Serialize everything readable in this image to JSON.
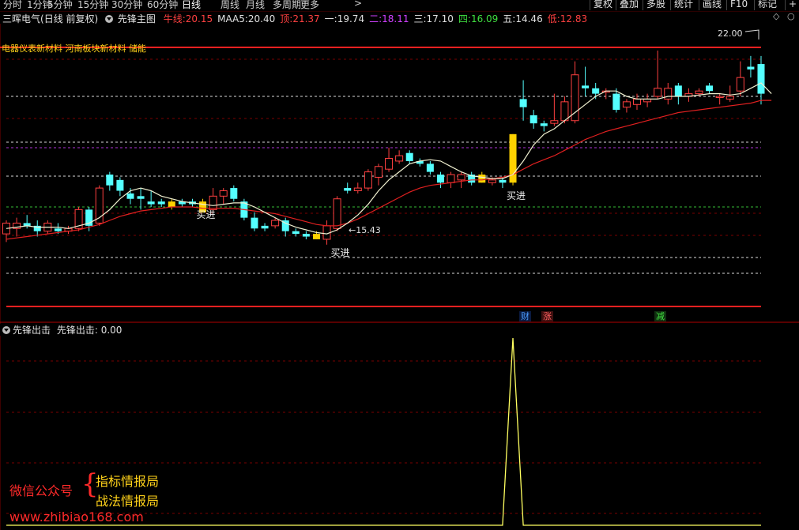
{
  "toolbar": {
    "periods": [
      "分时",
      "1分钟",
      "5分钟",
      "15分钟",
      "30分钟",
      "60分钟",
      "日线",
      "周线",
      "月线",
      "多周期",
      "更多"
    ],
    "active_period": "日线",
    "more_arrow": ">",
    "right_buttons": [
      "复权",
      "叠加",
      "多股",
      "统计",
      "画线",
      "F10",
      "标记"
    ],
    "end_mark": "+"
  },
  "main_panel": {
    "stock": "三晖电气",
    "adjust": "(日线 前复权)",
    "indicator": "先锋主图",
    "values": [
      {
        "label": "牛线:",
        "value": "20.15",
        "color": "#ff4040"
      },
      {
        "label": "MAA5:",
        "value": "20.40",
        "color": "#e0e0e0"
      },
      {
        "label": "顶:",
        "value": "21.37",
        "color": "#ff4040"
      },
      {
        "label": "一:",
        "value": "19.74",
        "color": "#e0e0e0"
      },
      {
        "label": "二:",
        "value": "18.11",
        "color": "#d040ff"
      },
      {
        "label": "三:",
        "value": "17.10",
        "color": "#e0e0e0"
      },
      {
        "label": "四:",
        "value": "16.09",
        "color": "#40e040"
      },
      {
        "label": "五:",
        "value": "14.46",
        "color": "#e0e0e0"
      },
      {
        "label": "低:",
        "value": "12.83",
        "color": "#ff4040"
      }
    ],
    "sectors": "电器仪表新材料 河南板块新材料 储能",
    "high_label": "22.00",
    "low_label": "←15.43",
    "buy_label": "买进",
    "tags": [
      {
        "text": "财",
        "color": "#4a9cff",
        "bg": "#0a1a40"
      },
      {
        "text": "涨",
        "color": "#ff6060",
        "bg": "#401010"
      },
      {
        "text": "减",
        "color": "#40e040",
        "bg": "#103010"
      }
    ]
  },
  "sub_panel": {
    "title": "先锋出击",
    "value_label": "先锋出击: 0.00"
  },
  "watermark": {
    "account": "微信公众号",
    "line1": "指标情报局",
    "line2": "战法情报局",
    "url": "www.zhibiao168.com"
  },
  "chart_data": {
    "type": "candlestick",
    "price_range": [
      12.83,
      22.0
    ],
    "guide_levels": [
      21.37,
      19.74,
      18.11,
      17.1,
      16.09,
      14.46,
      12.83
    ],
    "candles": [
      {
        "o": 15.2,
        "h": 15.7,
        "l": 14.9,
        "c": 15.6,
        "color": "red"
      },
      {
        "o": 15.4,
        "h": 15.8,
        "l": 15.1,
        "c": 15.6,
        "color": "red"
      },
      {
        "o": 15.6,
        "h": 15.9,
        "l": 15.4,
        "c": 15.5,
        "color": "cyan"
      },
      {
        "o": 15.5,
        "h": 15.7,
        "l": 15.1,
        "c": 15.3,
        "color": "cyan"
      },
      {
        "o": 15.3,
        "h": 15.7,
        "l": 15.2,
        "c": 15.6,
        "color": "red"
      },
      {
        "o": 15.4,
        "h": 15.6,
        "l": 15.2,
        "c": 15.3,
        "color": "cyan"
      },
      {
        "o": 15.3,
        "h": 15.5,
        "l": 15.2,
        "c": 15.4,
        "color": "red"
      },
      {
        "o": 15.4,
        "h": 16.2,
        "l": 15.3,
        "c": 16.1,
        "color": "red"
      },
      {
        "o": 16.1,
        "h": 16.2,
        "l": 15.3,
        "c": 15.5,
        "color": "cyan"
      },
      {
        "o": 15.6,
        "h": 17.0,
        "l": 15.5,
        "c": 16.9,
        "color": "red"
      },
      {
        "o": 17.0,
        "h": 17.5,
        "l": 16.8,
        "c": 17.4,
        "color": "cyan"
      },
      {
        "o": 17.2,
        "h": 17.3,
        "l": 16.6,
        "c": 16.8,
        "color": "cyan"
      },
      {
        "o": 16.7,
        "h": 16.9,
        "l": 16.3,
        "c": 16.5,
        "color": "cyan"
      },
      {
        "o": 16.5,
        "h": 16.9,
        "l": 16.1,
        "c": 16.6,
        "color": "cyan"
      },
      {
        "o": 16.4,
        "h": 16.8,
        "l": 16.2,
        "c": 16.3,
        "color": "cyan"
      },
      {
        "o": 16.4,
        "h": 16.5,
        "l": 16.2,
        "c": 16.3,
        "color": "cyan"
      },
      {
        "o": 16.4,
        "h": 16.5,
        "l": 16.1,
        "c": 16.2,
        "color": "yellow"
      },
      {
        "o": 16.4,
        "h": 16.5,
        "l": 16.2,
        "c": 16.3,
        "color": "cyan"
      },
      {
        "o": 16.4,
        "h": 16.5,
        "l": 16.2,
        "c": 16.3,
        "color": "cyan"
      },
      {
        "o": 16.4,
        "h": 16.5,
        "l": 16.0,
        "c": 16.0,
        "color": "yellow"
      },
      {
        "o": 16.1,
        "h": 16.9,
        "l": 16.0,
        "c": 16.6,
        "color": "red"
      },
      {
        "o": 16.6,
        "h": 16.9,
        "l": 16.3,
        "c": 16.8,
        "color": "red"
      },
      {
        "o": 16.9,
        "h": 17.0,
        "l": 16.4,
        "c": 16.5,
        "color": "cyan"
      },
      {
        "o": 16.4,
        "h": 16.5,
        "l": 15.7,
        "c": 15.8,
        "color": "cyan"
      },
      {
        "o": 15.8,
        "h": 16.0,
        "l": 15.3,
        "c": 15.4,
        "color": "cyan"
      },
      {
        "o": 15.4,
        "h": 15.6,
        "l": 15.3,
        "c": 15.5,
        "color": "cyan"
      },
      {
        "o": 15.5,
        "h": 15.8,
        "l": 15.4,
        "c": 15.7,
        "color": "red"
      },
      {
        "o": 15.7,
        "h": 15.8,
        "l": 15.1,
        "c": 15.3,
        "color": "cyan"
      },
      {
        "o": 15.3,
        "h": 15.4,
        "l": 15.1,
        "c": 15.2,
        "color": "cyan"
      },
      {
        "o": 15.2,
        "h": 15.3,
        "l": 15.0,
        "c": 15.1,
        "color": "cyan"
      },
      {
        "o": 15.2,
        "h": 15.3,
        "l": 15.0,
        "c": 15.0,
        "color": "yellow"
      },
      {
        "o": 15.0,
        "h": 15.7,
        "l": 14.8,
        "c": 15.5,
        "color": "red"
      },
      {
        "o": 15.4,
        "h": 16.6,
        "l": 15.3,
        "c": 16.5,
        "color": "red"
      },
      {
        "o": 16.9,
        "h": 17.1,
        "l": 16.7,
        "c": 16.8,
        "color": "cyan"
      },
      {
        "o": 16.8,
        "h": 17.1,
        "l": 16.7,
        "c": 16.9,
        "color": "red"
      },
      {
        "o": 16.9,
        "h": 17.6,
        "l": 16.8,
        "c": 17.5,
        "color": "red"
      },
      {
        "o": 17.3,
        "h": 17.8,
        "l": 17.0,
        "c": 17.7,
        "color": "red"
      },
      {
        "o": 17.6,
        "h": 18.4,
        "l": 17.5,
        "c": 18.0,
        "color": "red"
      },
      {
        "o": 17.9,
        "h": 18.3,
        "l": 17.8,
        "c": 18.1,
        "color": "red"
      },
      {
        "o": 18.2,
        "h": 18.3,
        "l": 17.8,
        "c": 17.9,
        "color": "cyan"
      },
      {
        "o": 17.9,
        "h": 18.0,
        "l": 17.7,
        "c": 17.8,
        "color": "cyan"
      },
      {
        "o": 17.8,
        "h": 17.9,
        "l": 17.4,
        "c": 17.5,
        "color": "cyan"
      },
      {
        "o": 17.4,
        "h": 17.5,
        "l": 16.9,
        "c": 17.1,
        "color": "cyan"
      },
      {
        "o": 17.1,
        "h": 17.5,
        "l": 16.9,
        "c": 17.4,
        "color": "red"
      },
      {
        "o": 17.2,
        "h": 17.5,
        "l": 16.9,
        "c": 17.4,
        "color": "red"
      },
      {
        "o": 17.4,
        "h": 17.5,
        "l": 17.0,
        "c": 17.1,
        "color": "cyan"
      },
      {
        "o": 17.4,
        "h": 17.5,
        "l": 17.1,
        "c": 17.1,
        "color": "yellow"
      },
      {
        "o": 17.1,
        "h": 17.3,
        "l": 17.0,
        "c": 17.2,
        "color": "red"
      },
      {
        "o": 17.2,
        "h": 17.3,
        "l": 16.9,
        "c": 17.1,
        "color": "cyan"
      },
      {
        "o": 17.1,
        "h": 18.9,
        "l": 17.0,
        "c": 18.9,
        "color": "yellow"
      },
      {
        "o": 20.2,
        "h": 20.9,
        "l": 19.4,
        "c": 19.9,
        "color": "cyan"
      },
      {
        "o": 19.6,
        "h": 19.8,
        "l": 19.1,
        "c": 19.3,
        "color": "cyan"
      },
      {
        "o": 19.3,
        "h": 19.4,
        "l": 19.0,
        "c": 19.2,
        "color": "cyan"
      },
      {
        "o": 19.3,
        "h": 20.4,
        "l": 19.2,
        "c": 19.4,
        "color": "red"
      },
      {
        "o": 19.4,
        "h": 20.3,
        "l": 19.3,
        "c": 20.1,
        "color": "red"
      },
      {
        "o": 19.4,
        "h": 21.6,
        "l": 19.3,
        "c": 21.1,
        "color": "red"
      },
      {
        "o": 20.7,
        "h": 21.4,
        "l": 20.3,
        "c": 20.6,
        "color": "cyan"
      },
      {
        "o": 20.6,
        "h": 20.8,
        "l": 20.2,
        "c": 20.4,
        "color": "cyan"
      },
      {
        "o": 20.5,
        "h": 20.6,
        "l": 20.2,
        "c": 20.5,
        "color": "red"
      },
      {
        "o": 20.4,
        "h": 20.6,
        "l": 19.7,
        "c": 19.8,
        "color": "cyan"
      },
      {
        "o": 19.9,
        "h": 20.2,
        "l": 19.7,
        "c": 20.1,
        "color": "red"
      },
      {
        "o": 20.0,
        "h": 20.4,
        "l": 19.8,
        "c": 20.2,
        "color": "red"
      },
      {
        "o": 20.1,
        "h": 20.4,
        "l": 19.9,
        "c": 20.2,
        "color": "red"
      },
      {
        "o": 20.3,
        "h": 22.0,
        "l": 20.2,
        "c": 20.6,
        "color": "red"
      },
      {
        "o": 20.6,
        "h": 20.8,
        "l": 20.0,
        "c": 20.2,
        "color": "red"
      },
      {
        "o": 20.7,
        "h": 20.8,
        "l": 20.0,
        "c": 20.3,
        "color": "cyan"
      },
      {
        "o": 20.4,
        "h": 20.6,
        "l": 20.1,
        "c": 20.3,
        "color": "red"
      },
      {
        "o": 20.4,
        "h": 20.6,
        "l": 20.3,
        "c": 20.5,
        "color": "red"
      },
      {
        "o": 20.7,
        "h": 20.8,
        "l": 20.4,
        "c": 20.5,
        "color": "cyan"
      },
      {
        "o": 20.3,
        "h": 20.4,
        "l": 20.0,
        "c": 20.3,
        "color": "red"
      },
      {
        "o": 20.2,
        "h": 20.7,
        "l": 20.1,
        "c": 20.3,
        "color": "red"
      },
      {
        "o": 20.5,
        "h": 21.6,
        "l": 20.3,
        "c": 21.0,
        "color": "red"
      },
      {
        "o": 21.3,
        "h": 21.8,
        "l": 21.0,
        "c": 21.4,
        "color": "cyan"
      },
      {
        "o": 21.5,
        "h": 21.8,
        "l": 20.0,
        "c": 20.4,
        "color": "cyan"
      }
    ],
    "ma5": [
      15.4,
      15.45,
      15.5,
      15.45,
      15.45,
      15.45,
      15.4,
      15.5,
      15.6,
      15.8,
      16.1,
      16.5,
      16.8,
      16.9,
      16.8,
      16.6,
      16.5,
      16.4,
      16.35,
      16.3,
      16.25,
      16.3,
      16.35,
      16.35,
      16.2,
      16.0,
      15.8,
      15.6,
      15.45,
      15.35,
      15.25,
      15.2,
      15.35,
      15.6,
      15.9,
      16.3,
      16.8,
      17.2,
      17.5,
      17.8,
      17.9,
      17.95,
      17.9,
      17.7,
      17.5,
      17.35,
      17.3,
      17.25,
      17.25,
      17.4,
      17.9,
      18.5,
      18.9,
      19.1,
      19.4,
      19.7,
      20.0,
      20.3,
      20.5,
      20.5,
      20.3,
      20.2,
      20.2,
      20.2,
      20.3,
      20.3,
      20.3,
      20.35,
      20.4,
      20.4,
      20.35,
      20.4,
      20.6,
      20.8,
      20.4
    ],
    "trend_line": [
      15.0,
      15.05,
      15.1,
      15.15,
      15.2,
      15.25,
      15.3,
      15.35,
      15.45,
      15.55,
      15.7,
      15.85,
      15.95,
      16.05,
      16.1,
      16.15,
      16.2,
      16.2,
      16.2,
      16.15,
      16.15,
      16.15,
      16.15,
      16.1,
      16.05,
      16.0,
      15.95,
      15.85,
      15.75,
      15.65,
      15.55,
      15.5,
      15.5,
      15.6,
      15.75,
      15.95,
      16.15,
      16.35,
      16.55,
      16.75,
      16.9,
      17.0,
      17.05,
      17.1,
      17.15,
      17.2,
      17.2,
      17.25,
      17.3,
      17.4,
      17.6,
      17.8,
      17.95,
      18.1,
      18.3,
      18.5,
      18.7,
      18.85,
      19.0,
      19.1,
      19.2,
      19.3,
      19.4,
      19.5,
      19.6,
      19.7,
      19.75,
      19.8,
      19.85,
      19.9,
      19.95,
      20.0,
      20.05,
      20.15,
      20.15
    ],
    "buy_signals": [
      18,
      31,
      48
    ],
    "sub_indicator": {
      "name": "先锋出击",
      "spike_index": 49,
      "spike_value": 1,
      "range": [
        0,
        1
      ]
    }
  }
}
